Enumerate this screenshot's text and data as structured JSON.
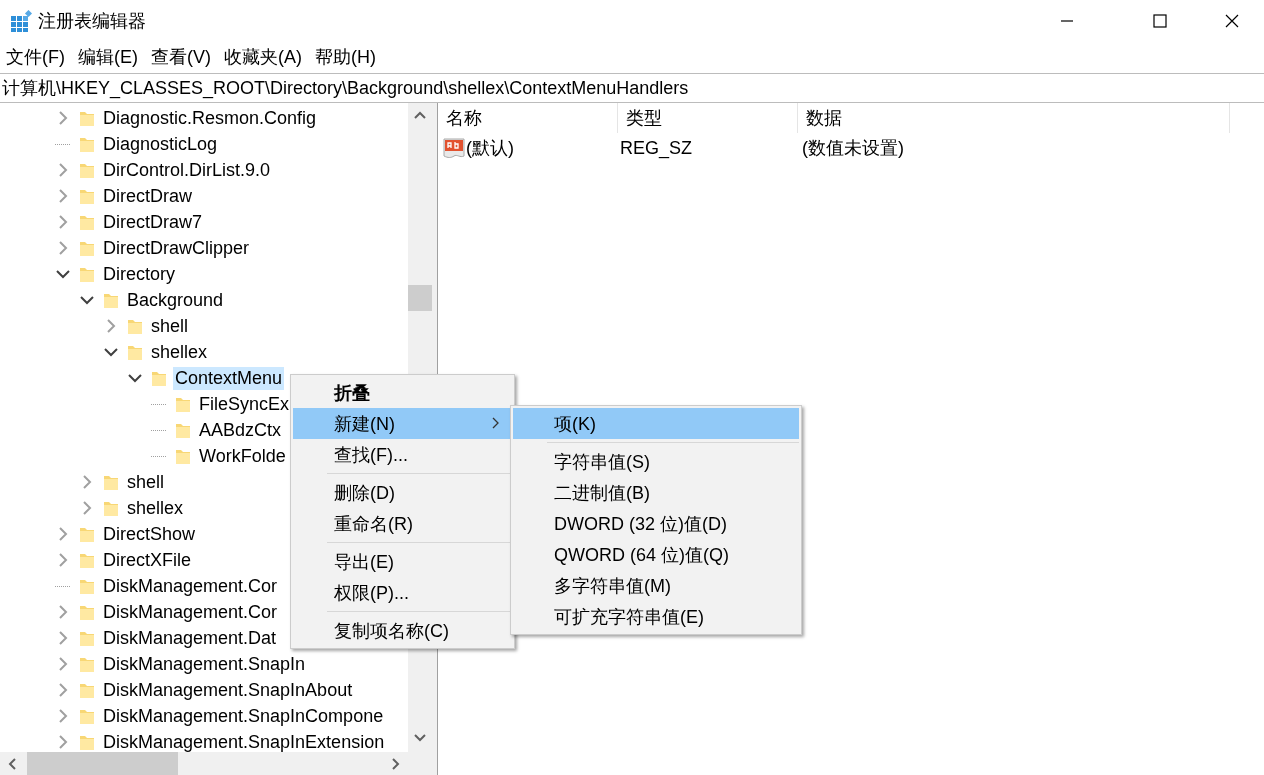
{
  "window": {
    "title": "注册表编辑器"
  },
  "menu_bar": [
    "文件(F)",
    "编辑(E)",
    "查看(V)",
    "收藏夹(A)",
    "帮助(H)"
  ],
  "address": "计算机\\HKEY_CLASSES_ROOT\\Directory\\Background\\shellex\\ContextMenuHandlers",
  "tree": [
    {
      "label": "Diagnostic.Resmon.Config",
      "kind": "branch",
      "expanded": false,
      "selected": false
    },
    {
      "label": "DiagnosticLog",
      "kind": "leaf",
      "selected": false
    },
    {
      "label": "DirControl.DirList.9.0",
      "kind": "branch",
      "expanded": false,
      "selected": false
    },
    {
      "label": "DirectDraw",
      "kind": "branch",
      "expanded": false,
      "selected": false
    },
    {
      "label": "DirectDraw7",
      "kind": "branch",
      "expanded": false,
      "selected": false
    },
    {
      "label": "DirectDrawClipper",
      "kind": "branch",
      "expanded": false,
      "selected": false
    },
    {
      "label": "Directory",
      "kind": "branch",
      "expanded": true,
      "selected": false,
      "children": [
        {
          "label": "Background",
          "kind": "branch",
          "expanded": true,
          "selected": false,
          "children": [
            {
              "label": "shell",
              "kind": "branch",
              "expanded": false,
              "selected": false
            },
            {
              "label": "shellex",
              "kind": "branch",
              "expanded": true,
              "selected": false,
              "children": [
                {
                  "label": "ContextMenu",
                  "kind": "branch",
                  "expanded": true,
                  "selected": true,
                  "children": [
                    {
                      "label": "FileSyncEx",
                      "kind": "leaf",
                      "selected": false
                    },
                    {
                      "label": "AABdzCtx",
                      "kind": "leaf",
                      "selected": false
                    },
                    {
                      "label": "WorkFolde",
                      "kind": "leaf",
                      "selected": false
                    }
                  ]
                }
              ]
            }
          ]
        },
        {
          "label": "shell",
          "kind": "branch",
          "expanded": false,
          "selected": false
        },
        {
          "label": "shellex",
          "kind": "branch",
          "expanded": false,
          "selected": false
        }
      ]
    },
    {
      "label": "DirectShow",
      "kind": "branch",
      "expanded": false,
      "selected": false
    },
    {
      "label": "DirectXFile",
      "kind": "branch",
      "expanded": false,
      "selected": false
    },
    {
      "label": "DiskManagement.Cor",
      "kind": "leaf",
      "selected": false
    },
    {
      "label": "DiskManagement.Cor",
      "kind": "branch",
      "expanded": false,
      "selected": false
    },
    {
      "label": "DiskManagement.Dat",
      "kind": "branch",
      "expanded": false,
      "selected": false
    },
    {
      "label": "DiskManagement.SnapIn",
      "kind": "branch",
      "expanded": false,
      "selected": false
    },
    {
      "label": "DiskManagement.SnapInAbout",
      "kind": "branch",
      "expanded": false,
      "selected": false
    },
    {
      "label": "DiskManagement.SnapInCompone",
      "kind": "branch",
      "expanded": false,
      "selected": false
    },
    {
      "label": "DiskManagement.SnapInExtension",
      "kind": "branch",
      "expanded": false,
      "selected": false
    }
  ],
  "values": {
    "columns": [
      "名称",
      "类型",
      "数据"
    ],
    "rows": [
      {
        "name": "(默认)",
        "type": "REG_SZ",
        "data": "(数值未设置)"
      }
    ]
  },
  "context_menu": {
    "items": [
      {
        "kind": "item",
        "label": "折叠",
        "default": true,
        "submenu": false,
        "selected": false
      },
      {
        "kind": "item",
        "label": "新建(N)",
        "default": false,
        "submenu": true,
        "selected": true
      },
      {
        "kind": "item",
        "label": "查找(F)...",
        "default": false,
        "submenu": false,
        "selected": false
      },
      {
        "kind": "separator"
      },
      {
        "kind": "item",
        "label": "删除(D)",
        "default": false,
        "submenu": false,
        "selected": false
      },
      {
        "kind": "item",
        "label": "重命名(R)",
        "default": false,
        "submenu": false,
        "selected": false
      },
      {
        "kind": "separator"
      },
      {
        "kind": "item",
        "label": "导出(E)",
        "default": false,
        "submenu": false,
        "selected": false
      },
      {
        "kind": "item",
        "label": "权限(P)...",
        "default": false,
        "submenu": false,
        "selected": false
      },
      {
        "kind": "separator"
      },
      {
        "kind": "item",
        "label": "复制项名称(C)",
        "default": false,
        "submenu": false,
        "selected": false
      }
    ]
  },
  "submenu": {
    "items": [
      {
        "kind": "item",
        "label": "项(K)",
        "default": false,
        "submenu": false,
        "selected": true
      },
      {
        "kind": "separator"
      },
      {
        "kind": "item",
        "label": "字符串值(S)",
        "default": false,
        "submenu": false,
        "selected": false
      },
      {
        "kind": "item",
        "label": "二进制值(B)",
        "default": false,
        "submenu": false,
        "selected": false
      },
      {
        "kind": "item",
        "label": "DWORD (32 位)值(D)",
        "default": false,
        "submenu": false,
        "selected": false
      },
      {
        "kind": "item",
        "label": "QWORD (64 位)值(Q)",
        "default": false,
        "submenu": false,
        "selected": false
      },
      {
        "kind": "item",
        "label": "多字符串值(M)",
        "default": false,
        "submenu": false,
        "selected": false
      },
      {
        "kind": "item",
        "label": "可扩充字符串值(E)",
        "default": false,
        "submenu": false,
        "selected": false
      }
    ]
  }
}
